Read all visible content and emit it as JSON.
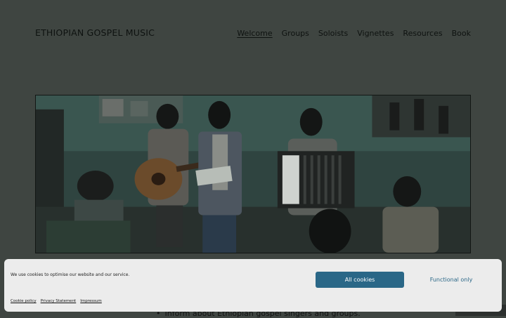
{
  "site": {
    "title": "ETHIOPIAN GOSPEL MUSIC"
  },
  "nav": {
    "items": [
      {
        "label": "Welcome",
        "active": true
      },
      {
        "label": "Groups"
      },
      {
        "label": "Soloists"
      },
      {
        "label": "Vignettes"
      },
      {
        "label": "Resources"
      },
      {
        "label": "Book"
      }
    ]
  },
  "hero": {
    "alt_icon": "musicians-photo"
  },
  "content": {
    "partial_bullet": "Inform about Ethiopian gospel singers and groups."
  },
  "cookie_banner": {
    "message": "We use cookies to optimise our website and our service.",
    "accept_all_label": "All cookies",
    "functional_label": "Functional only",
    "links": [
      "Cookie policy",
      "Privacy Statement",
      "Impressum"
    ],
    "accent_color": "#2a6787"
  }
}
